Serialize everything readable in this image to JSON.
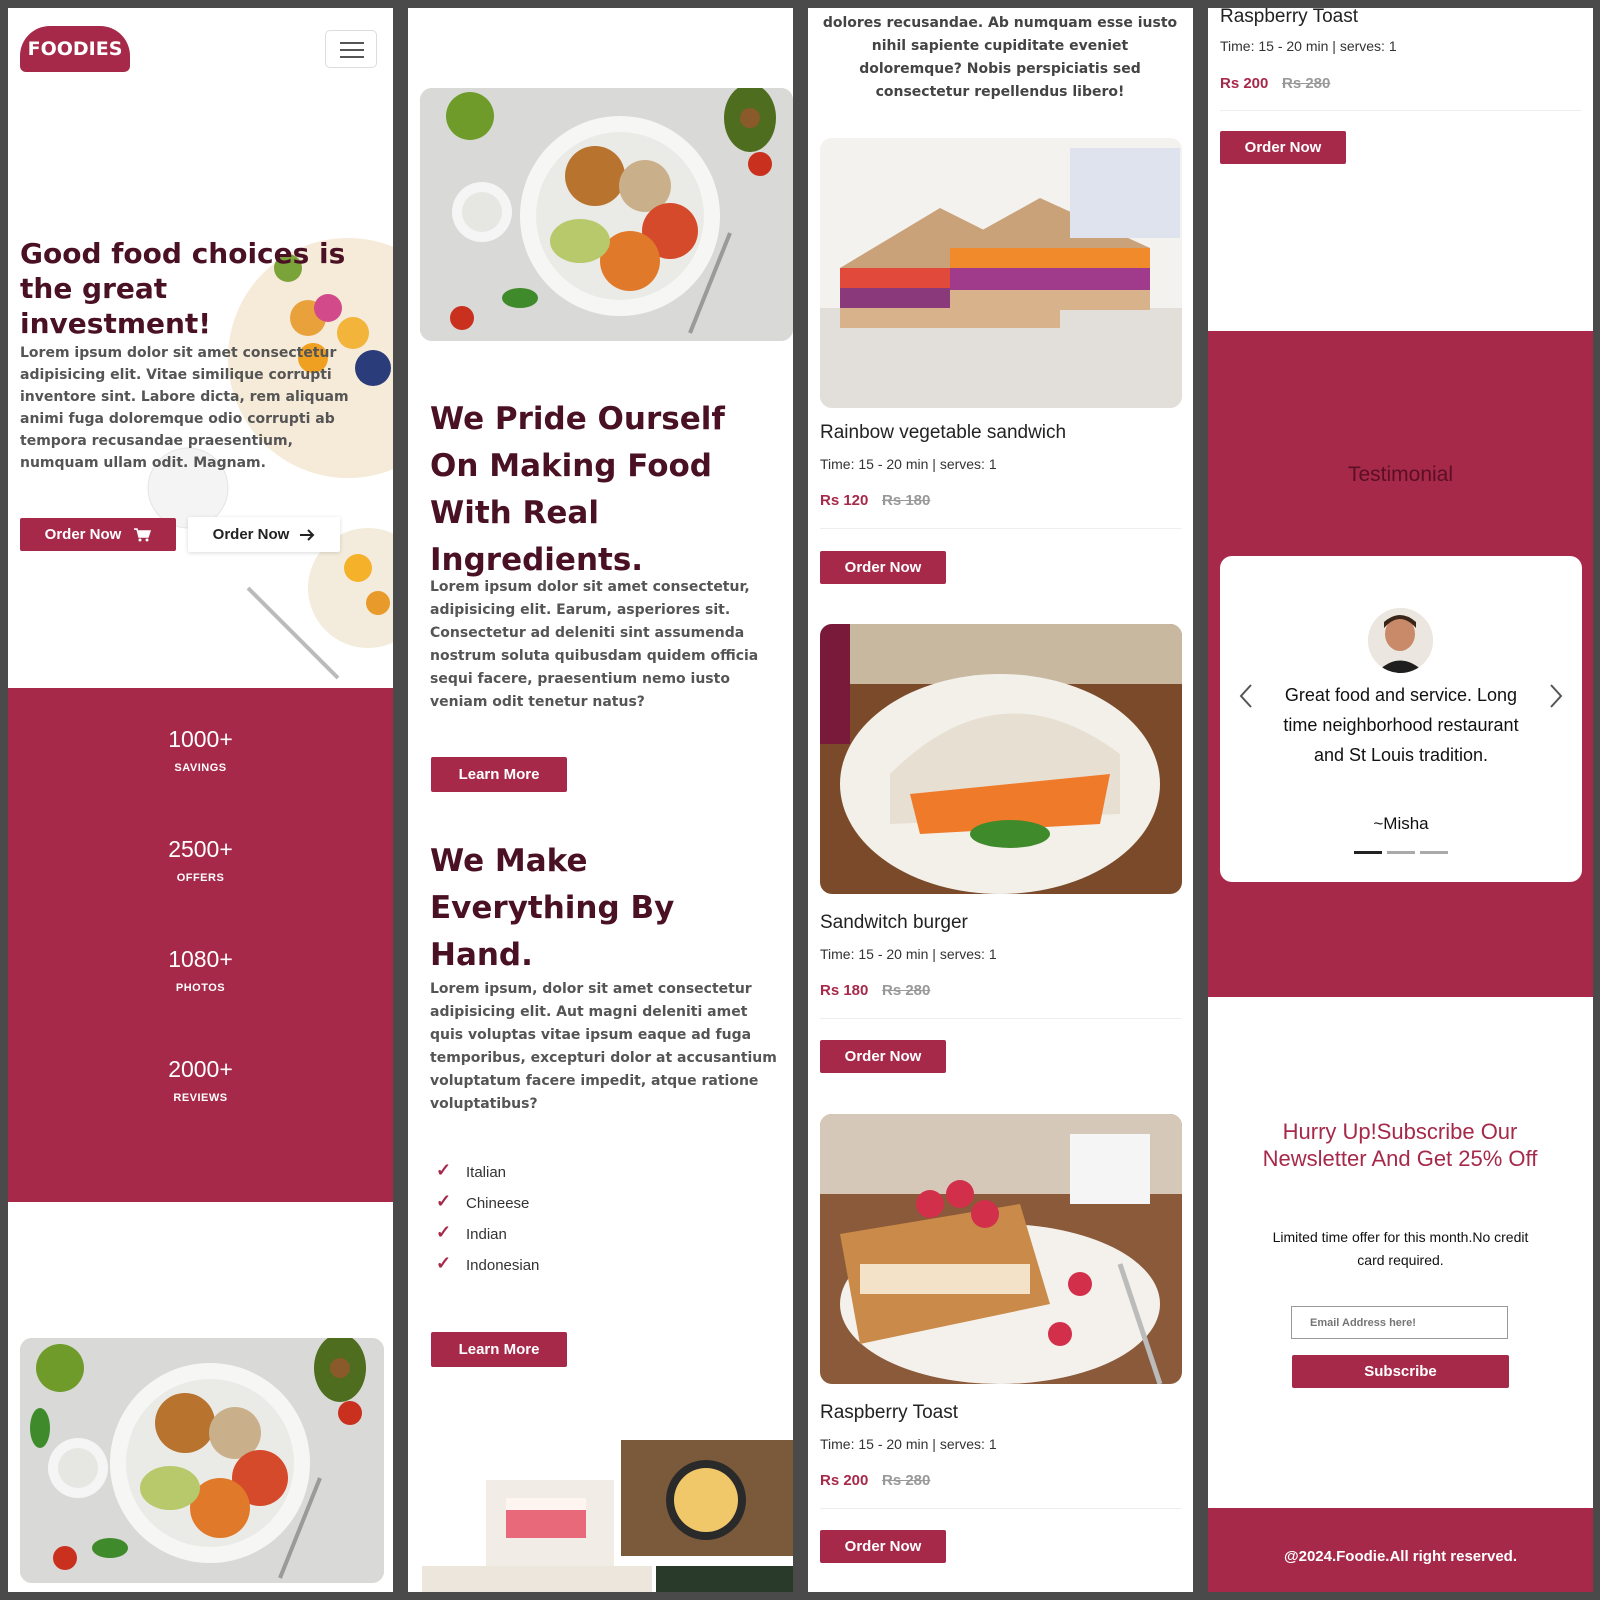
{
  "brand": {
    "logo": "FOODIES"
  },
  "hero": {
    "title": "Good food choices is the great investment!",
    "body": "Lorem ipsum dolor sit amet consectetur adipisicing elit. Vitae similique corrupti inventore sint. Labore dicta, rem aliquam animi fuga doloremque odio corrupti ab tempora recusandae praesentium, numquam ullam odit. Magnam.",
    "order_primary": "Order Now",
    "order_secondary": "Order Now"
  },
  "stats": [
    {
      "value": "1000+",
      "label": "SAVINGS"
    },
    {
      "value": "2500+",
      "label": "OFFERS"
    },
    {
      "value": "1080+",
      "label": "PHOTOS"
    },
    {
      "value": "2000+",
      "label": "REVIEWS"
    }
  ],
  "about": {
    "title": "We Pride Ourself On Making Food With Real Ingredients.",
    "body": "Lorem ipsum dolor sit amet consectetur, adipisicing elit. Earum, asperiores sit. Consectetur ad deleniti sint assumenda nostrum soluta quibusdam quidem officia sequi facere, praesentium nemo iusto veniam odit tenetur natus?",
    "button": "Learn More"
  },
  "handmade": {
    "title": "We Make Everything By Hand.",
    "body": "Lorem ipsum, dolor sit amet consectetur adipisicing elit. Aut magni deleniti amet quis voluptas vitae ipsum eaque ad fuga temporibus, excepturi dolor at accusantium voluptatum facere impedit, atque ratione voluptatibus?",
    "cuisines": [
      "Italian",
      "Chineese",
      "Indian",
      "Indonesian"
    ],
    "button": "Learn More"
  },
  "menu": {
    "intro_tail": "dolores recusandae. Ab numquam esse iusto nihil sapiente cupiditate eveniet doloremque? Nobis perspiciatis sed consectetur repellendus libero!",
    "items": [
      {
        "name": "Rainbow vegetable sandwich",
        "meta": "Time: 15 - 20 min | serves: 1",
        "price": "Rs 120",
        "old_price": "Rs 180",
        "button": "Order Now"
      },
      {
        "name": "Sandwitch burger",
        "meta": "Time: 15 - 20 min | serves: 1",
        "price": "Rs 180",
        "old_price": "Rs 280",
        "button": "Order Now"
      },
      {
        "name": "Raspberry Toast",
        "meta": "Time: 15 - 20 min | serves: 1",
        "price": "Rs 200",
        "old_price": "Rs 280",
        "button": "Order Now"
      }
    ],
    "top_item": {
      "name": "Raspberry Toast",
      "meta": "Time: 15 - 20 min | serves: 1",
      "price": "Rs 200",
      "old_price": "Rs 280",
      "button": "Order Now"
    }
  },
  "testimonial": {
    "heading": "Testimonial",
    "quote": "Great food and service. Long time neighborhood restaurant and St Louis tradition.",
    "author": "~Misha"
  },
  "newsletter": {
    "title": "Hurry Up!Subscribe Our Newsletter And Get 25% Off",
    "subtitle": "Limited time offer for this month.No credit card required.",
    "placeholder": "Email Address here!",
    "button": "Subscribe"
  },
  "footer": {
    "copyright": "@2024.Foodie.All right reserved."
  },
  "colors": {
    "accent": "#a6294a",
    "heading": "#4a1024"
  }
}
